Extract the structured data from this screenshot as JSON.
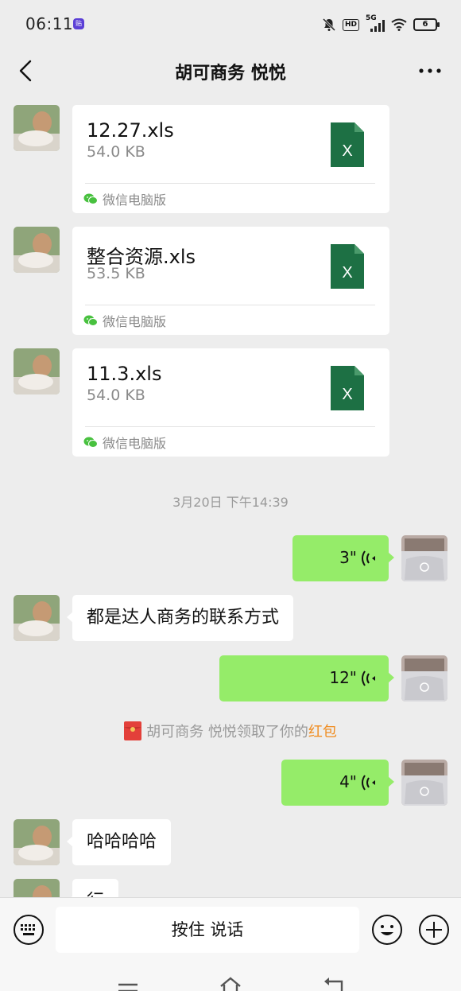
{
  "status_bar": {
    "time": "06:11",
    "badge_text": "贴",
    "hd_label": "HD",
    "network_label": "5G",
    "battery_level": "6"
  },
  "header": {
    "title": "胡可商务  悦悦"
  },
  "messages": {
    "files": [
      {
        "name": "12.27.xls",
        "size": "54.0 KB",
        "source": "微信电脑版"
      },
      {
        "name": "整合资源.xls",
        "size": "53.5 KB",
        "source": "微信电脑版"
      },
      {
        "name": "11.3.xls",
        "size": "54.0 KB",
        "source": "微信电脑版"
      }
    ],
    "timestamp": "3月20日 下午14:39",
    "voice_1": "3\"",
    "text_1": "都是达人商务的联系方式",
    "voice_2": "12\"",
    "redpacket_notice": "胡可商务  悦悦领取了你的",
    "redpacket_link": "红包",
    "voice_3": "4\"",
    "text_2": "哈哈哈哈",
    "text_3_partial": "行"
  },
  "input_bar": {
    "hold_to_talk": "按住 说话"
  },
  "colors": {
    "background": "#ededed",
    "sent_bubble": "#95ec69",
    "excel_green": "#1d7044",
    "link_orange": "#f08c1f"
  },
  "icons": [
    "back-icon",
    "more-icon",
    "excel-file-icon",
    "wechat-icon",
    "voice-wave-icon",
    "red-packet-icon",
    "keyboard-icon",
    "emoji-icon",
    "plus-icon",
    "menu-icon",
    "home-icon",
    "back-nav-icon"
  ]
}
